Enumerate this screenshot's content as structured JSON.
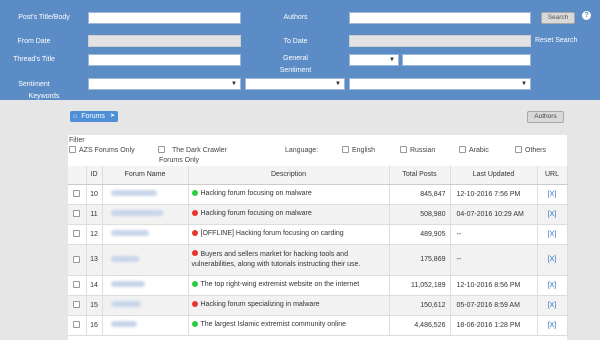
{
  "search": {
    "labels": {
      "title_body": "Post's Title/Body",
      "authors": "Authors",
      "from_date": "From Date",
      "to_date": "To Date",
      "thread_title": "Thread's Title",
      "general_sentiment_1": "General",
      "general_sentiment_2": "Sentiment",
      "sentiment_keywords_1": "Sentiment",
      "sentiment_keywords_2": "Keywords"
    },
    "values": {
      "title_body": "",
      "authors": "",
      "from_date": "",
      "to_date": "",
      "thread_title": "",
      "general_sentiment": "",
      "general_sentiment_text": "",
      "keyword_1": "",
      "keyword_2": "",
      "keyword_3": ""
    },
    "search_button": "Search",
    "help_symbol": "?",
    "reset_link": "Reset Search"
  },
  "breadcrumb": {
    "home_icon": "home-icon",
    "label": "Forums",
    "arrow_icon": "chevron-right-icon"
  },
  "authors_button": "Authors",
  "filter": {
    "title": "Filter",
    "azs_only": "AZS Forums Only",
    "dark_crawler_1": "The Dark Crawler",
    "dark_crawler_2": "Forums Only",
    "language_label": "Language:",
    "languages": [
      "English",
      "Russian",
      "Arabic",
      "Others"
    ]
  },
  "table": {
    "headers": [
      "",
      "ID",
      "Forum Name",
      "Description",
      "Total Posts",
      "Last Updated",
      "URL"
    ],
    "rows": [
      {
        "id": "10",
        "status": "green",
        "description": "Hacking forum focusing on malware",
        "posts": "845,847",
        "updated": "12-10-2016 7:56 PM",
        "url": "[X]"
      },
      {
        "id": "11",
        "status": "red",
        "description": "Hacking forum focusing on malware",
        "posts": "508,980",
        "updated": "04-07-2016 10:29 AM",
        "url": "[X]"
      },
      {
        "id": "12",
        "status": "red",
        "description": "[OFFLINE] Hacking forum focusing on carding",
        "posts": "489,905",
        "updated": "--",
        "url": "[X]"
      },
      {
        "id": "13",
        "status": "red",
        "description": "Buyers and sellers market for hacking tools and vulnerabilities, along with tutorials instructing their use.",
        "posts": "175,869",
        "updated": "--",
        "url": "[X]"
      },
      {
        "id": "14",
        "status": "green",
        "description": "The top right-wing extremist website on the internet",
        "posts": "11,052,189",
        "updated": "12-10-2016 8:56 PM",
        "url": "[X]"
      },
      {
        "id": "15",
        "status": "red",
        "description": "Hacking forum specializing in malware",
        "posts": "150,612",
        "updated": "05-07-2016 8:59 AM",
        "url": "[X]"
      },
      {
        "id": "16",
        "status": "green",
        "description": "The largest Islamic extremist community online",
        "posts": "4,486,526",
        "updated": "18-06-2016 1:28 PM",
        "url": "[X]"
      }
    ]
  },
  "colors": {
    "panel": "#5b8cc6",
    "green": "#2ecc40",
    "red": "#e8362b",
    "link": "#2a6ebd"
  }
}
